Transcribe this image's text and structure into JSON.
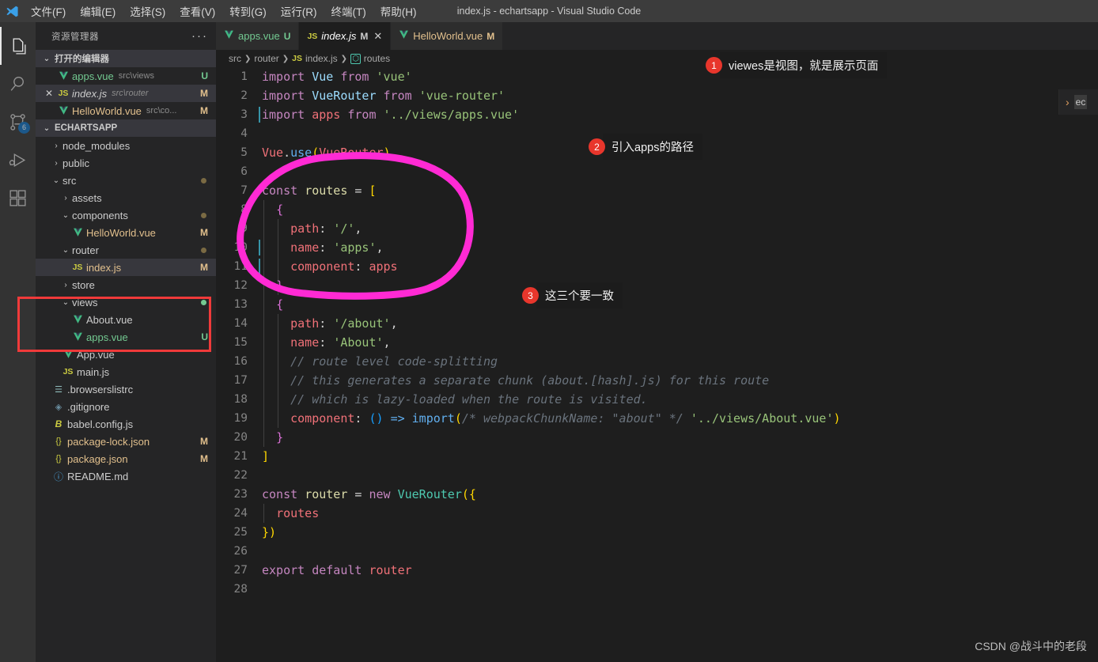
{
  "titlebar": {
    "title": "index.js - echartsapp - Visual Studio Code",
    "logo_icon": "vscode-logo-icon",
    "menus": [
      {
        "label": "文件(F)",
        "name": "menu-file"
      },
      {
        "label": "编辑(E)",
        "name": "menu-edit"
      },
      {
        "label": "选择(S)",
        "name": "menu-selection"
      },
      {
        "label": "查看(V)",
        "name": "menu-view"
      },
      {
        "label": "转到(G)",
        "name": "menu-go"
      },
      {
        "label": "运行(R)",
        "name": "menu-run"
      },
      {
        "label": "终端(T)",
        "name": "menu-terminal"
      },
      {
        "label": "帮助(H)",
        "name": "menu-help"
      }
    ]
  },
  "activitybar": {
    "items": [
      {
        "name": "activity-explorer",
        "icon": "files-icon",
        "active": true,
        "badge": ""
      },
      {
        "name": "activity-search",
        "icon": "search-icon",
        "active": false,
        "badge": ""
      },
      {
        "name": "activity-source-control",
        "icon": "source-control-icon",
        "active": false,
        "badge": "6"
      },
      {
        "name": "activity-run-debug",
        "icon": "run-debug-icon",
        "active": false,
        "badge": ""
      },
      {
        "name": "activity-extensions",
        "icon": "extensions-icon",
        "active": false,
        "badge": ""
      }
    ]
  },
  "sidebar": {
    "header_title": "资源管理器",
    "more_actions": "···",
    "open_editors": {
      "title": "打开的编辑器",
      "items": [
        {
          "name": "apps.vue",
          "desc": "src\\views",
          "status": "U",
          "status_color": "#73c991",
          "icon": "vue-icon",
          "selected": false,
          "close": false
        },
        {
          "name": "index.js",
          "desc": "src\\router",
          "status": "M",
          "status_color": "#e2c08d",
          "icon": "js-icon",
          "selected": true,
          "close": true
        },
        {
          "name": "HelloWorld.vue",
          "desc": "src\\co...",
          "status": "M",
          "status_color": "#e2c08d",
          "icon": "vue-icon",
          "selected": false,
          "close": false
        }
      ]
    },
    "project": {
      "title": "ECHARTSAPP",
      "tree": [
        {
          "label": "node_modules",
          "type": "folder",
          "expanded": false,
          "indent": 1,
          "status": "",
          "dot": ""
        },
        {
          "label": "public",
          "type": "folder",
          "expanded": false,
          "indent": 1,
          "status": "",
          "dot": ""
        },
        {
          "label": "src",
          "type": "folder",
          "expanded": true,
          "indent": 1,
          "status": "",
          "dot": "yellow"
        },
        {
          "label": "assets",
          "type": "folder",
          "expanded": false,
          "indent": 2,
          "status": "",
          "dot": ""
        },
        {
          "label": "components",
          "type": "folder",
          "expanded": true,
          "indent": 2,
          "status": "",
          "dot": "yellow"
        },
        {
          "label": "HelloWorld.vue",
          "type": "vue",
          "expanded": false,
          "indent": 3,
          "status": "M",
          "status_color": "#e2c08d",
          "dot": ""
        },
        {
          "label": "router",
          "type": "folder",
          "expanded": true,
          "indent": 2,
          "status": "",
          "dot": "yellow"
        },
        {
          "label": "index.js",
          "type": "js",
          "expanded": false,
          "indent": 3,
          "status": "M",
          "status_color": "#e2c08d",
          "dot": "",
          "selected": true
        },
        {
          "label": "store",
          "type": "folder",
          "expanded": false,
          "indent": 2,
          "status": "",
          "dot": ""
        },
        {
          "label": "views",
          "type": "folder",
          "expanded": true,
          "indent": 2,
          "status": "",
          "dot": "green"
        },
        {
          "label": "About.vue",
          "type": "vue",
          "expanded": false,
          "indent": 3,
          "status": "",
          "dot": ""
        },
        {
          "label": "apps.vue",
          "type": "vue",
          "expanded": false,
          "indent": 3,
          "status": "U",
          "status_color": "#73c991",
          "dot": "",
          "untracked": true
        },
        {
          "label": "App.vue",
          "type": "vue",
          "expanded": false,
          "indent": 2,
          "status": "",
          "dot": ""
        },
        {
          "label": "main.js",
          "type": "js",
          "expanded": false,
          "indent": 2,
          "status": "",
          "dot": ""
        },
        {
          "label": ".browserslistrc",
          "type": "config",
          "expanded": false,
          "indent": 1,
          "status": "",
          "dot": ""
        },
        {
          "label": ".gitignore",
          "type": "git",
          "expanded": false,
          "indent": 1,
          "status": "",
          "dot": ""
        },
        {
          "label": "babel.config.js",
          "type": "babel",
          "expanded": false,
          "indent": 1,
          "status": "",
          "dot": ""
        },
        {
          "label": "package-lock.json",
          "type": "json",
          "expanded": false,
          "indent": 1,
          "status": "M",
          "status_color": "#e2c08d",
          "dot": ""
        },
        {
          "label": "package.json",
          "type": "json",
          "expanded": false,
          "indent": 1,
          "status": "M",
          "status_color": "#e2c08d",
          "dot": ""
        },
        {
          "label": "README.md",
          "type": "readme",
          "expanded": false,
          "indent": 1,
          "status": "",
          "dot": ""
        }
      ]
    }
  },
  "editor": {
    "tabs": [
      {
        "label": "apps.vue",
        "status": "U",
        "status_color": "#73c991",
        "icon": "vue-icon",
        "active": false,
        "closable": false
      },
      {
        "label": "index.js",
        "status": "M",
        "status_color": "#cccccc",
        "icon": "js-icon",
        "active": true,
        "closable": true,
        "close_glyph": "✕"
      },
      {
        "label": "HelloWorld.vue",
        "status": "M",
        "status_color": "#e2c08d",
        "icon": "vue-icon",
        "active": false,
        "closable": false
      }
    ],
    "breadcrumb": [
      "src",
      "router",
      "index.js",
      "routes"
    ],
    "breadcrumb_file_icon": "js-icon",
    "breadcrumb_symbol_icon": "variable-symbol-icon",
    "code_lines": [
      {
        "n": "1",
        "html": "<span class=\"t-kw\">import</span> <span class=\"t-var\">Vue</span> <span class=\"t-kw\">from</span> <span class=\"t-str2\">'vue'</span>"
      },
      {
        "n": "2",
        "html": "<span class=\"t-kw\">import</span> <span class=\"t-var\">VueRouter</span> <span class=\"t-kw\">from</span> <span class=\"t-str2\">'vue-router'</span>"
      },
      {
        "n": "3",
        "html": "<span class=\"t-kw\">import</span> <span class=\"t-id\">apps</span> <span class=\"t-kw\">from</span> <span class=\"t-str2\">'../views/apps.vue'</span>"
      },
      {
        "n": "4",
        "html": ""
      },
      {
        "n": "5",
        "html": "<span class=\"t-id\">Vue</span><span class=\"t-op\">.</span><span class=\"t-use\">use</span><span class=\"t-br1\">(</span><span class=\"t-id\">VueRouter</span><span class=\"t-br1\">)</span>"
      },
      {
        "n": "6",
        "html": ""
      },
      {
        "n": "7",
        "html": "<span class=\"t-kw\">const</span> <span class=\"t-func\">routes</span> <span class=\"t-op\">=</span> <span class=\"t-br1\">[</span>"
      },
      {
        "n": "8",
        "html": "  <span class=\"t-br2\">{</span>"
      },
      {
        "n": "9",
        "html": "    <span class=\"t-prop\">path</span><span class=\"t-op\">:</span> <span class=\"t-str2\">'/'</span><span class=\"t-op\">,</span>"
      },
      {
        "n": "10",
        "html": "    <span class=\"t-prop\">name</span><span class=\"t-op\">:</span> <span class=\"t-str2\">'apps'</span><span class=\"t-op\">,</span>"
      },
      {
        "n": "11",
        "html": "    <span class=\"t-prop\">component</span><span class=\"t-op\">:</span> <span class=\"t-id\">apps</span>"
      },
      {
        "n": "12",
        "html": "  <span class=\"t-br2\">}</span><span class=\"t-op\">,</span>"
      },
      {
        "n": "13",
        "html": "  <span class=\"t-br2\">{</span>"
      },
      {
        "n": "14",
        "html": "    <span class=\"t-prop\">path</span><span class=\"t-op\">:</span> <span class=\"t-str2\">'/about'</span><span class=\"t-op\">,</span>"
      },
      {
        "n": "15",
        "html": "    <span class=\"t-prop\">name</span><span class=\"t-op\">:</span> <span class=\"t-str2\">'About'</span><span class=\"t-op\">,</span>"
      },
      {
        "n": "16",
        "html": "    <span class=\"t-com\">// route level code-splitting</span>"
      },
      {
        "n": "17",
        "html": "    <span class=\"t-com\">// this generates a separate chunk (about.[hash].js) for this route</span>"
      },
      {
        "n": "18",
        "html": "    <span class=\"t-com\">// which is lazy-loaded when the route is visited.</span>"
      },
      {
        "n": "19",
        "html": "    <span class=\"t-prop\">component</span><span class=\"t-op\">:</span> <span class=\"t-br3\">(</span><span class=\"t-br3\">)</span> <span class=\"t-use\">=&gt;</span> <span class=\"t-use\">import</span><span class=\"t-br1\">(</span><span class=\"t-com\">/* webpackChunkName: \"about\" */</span> <span class=\"t-str2\">'../views/About.vue'</span><span class=\"t-br1\">)</span>"
      },
      {
        "n": "20",
        "html": "  <span class=\"t-br2\">}</span>"
      },
      {
        "n": "21",
        "html": "<span class=\"t-br1\">]</span>"
      },
      {
        "n": "22",
        "html": ""
      },
      {
        "n": "23",
        "html": "<span class=\"t-kw\">const</span> <span class=\"t-func\">router</span> <span class=\"t-op\">=</span> <span class=\"t-kw\">new</span> <span class=\"t-cls\">VueRouter</span><span class=\"t-br1\">(</span><span class=\"t-br1\">{</span>"
      },
      {
        "n": "24",
        "html": "  <span class=\"t-id\">routes</span>"
      },
      {
        "n": "25",
        "html": "<span class=\"t-br1\">}</span><span class=\"t-br1\">)</span>"
      },
      {
        "n": "26",
        "html": ""
      },
      {
        "n": "27",
        "html": "<span class=\"t-kw\">export</span> <span class=\"t-kw\">default</span> <span class=\"t-id\">router</span>"
      },
      {
        "n": "28",
        "html": ""
      }
    ]
  },
  "peek_panel": {
    "chevron": "›",
    "text": "ec"
  },
  "annotations": {
    "callouts": [
      {
        "num": "1",
        "text": "viewes是视图，就是展示页面",
        "name": "annotation-callout-1"
      },
      {
        "num": "2",
        "text": "引入apps的路径",
        "name": "annotation-callout-2"
      },
      {
        "num": "3",
        "text": "这三个要一致",
        "name": "annotation-callout-3"
      }
    ],
    "red_box_color": "#f03a3a",
    "magenta_circle_color": "#ff2ad4"
  },
  "watermark": "CSDN @战斗中的老段"
}
